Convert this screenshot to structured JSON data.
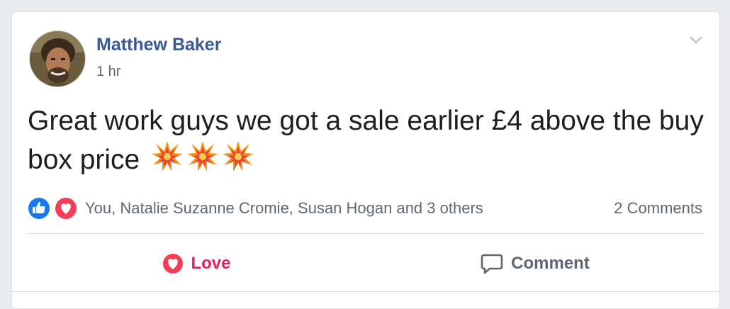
{
  "post": {
    "author": "Matthew Baker",
    "timestamp": "1 hr",
    "text": "Great work guys we got a sale earlier £4 above the buy box price",
    "emojis": [
      "collision-emoji",
      "collision-emoji",
      "collision-emoji"
    ]
  },
  "reactions": {
    "icons": [
      "like-icon",
      "love-icon"
    ],
    "summary": "You, Natalie Suzanne Cromie, Susan Hogan and 3 others",
    "comments_count": "2 Comments"
  },
  "actions": {
    "love_label": "Love",
    "comment_label": "Comment"
  },
  "colors": {
    "author_link": "#385898",
    "love_red": "#e0245e",
    "like_blue": "#1877f2",
    "muted_text": "#606770"
  }
}
